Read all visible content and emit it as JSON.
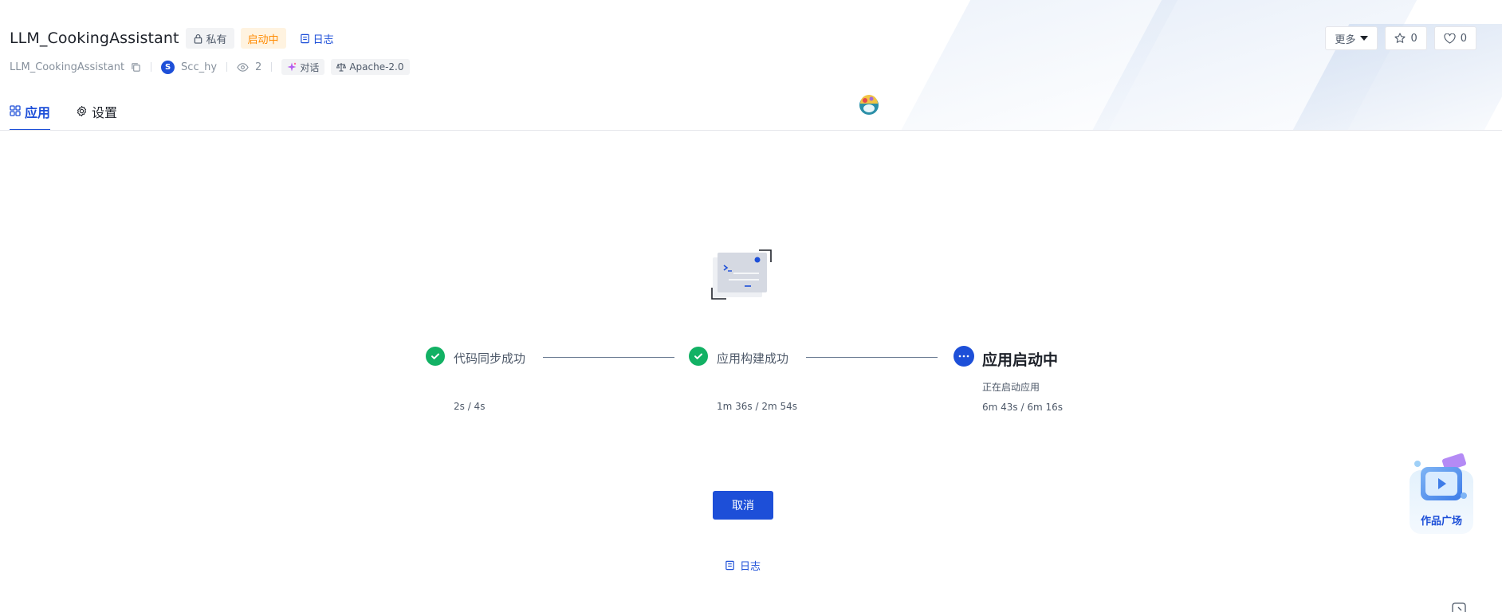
{
  "header": {
    "title": "LLM_CookingAssistant",
    "private_label": "私有",
    "status_label": "启动中",
    "log_label": "日志",
    "repo_name": "LLM_CookingAssistant",
    "owner_avatar": "S",
    "owner_name": "Scc_hy",
    "views": "2",
    "category_tag": "对话",
    "license_tag": "Apache-2.0"
  },
  "actions": {
    "more_label": "更多",
    "star_count": "0",
    "like_count": "0"
  },
  "tabs": [
    {
      "label": "应用",
      "icon": "apps-icon",
      "active": true
    },
    {
      "label": "设置",
      "icon": "gear-icon",
      "active": false
    }
  ],
  "steps": [
    {
      "title": "代码同步成功",
      "time": "2s / 4s",
      "state": "done"
    },
    {
      "title": "应用构建成功",
      "time": "1m 36s / 2m 54s",
      "state": "done"
    },
    {
      "title": "应用启动中",
      "desc": "正在启动应用",
      "time": "6m 43s / 6m 16s",
      "state": "in-progress"
    }
  ],
  "cancel_label": "取消",
  "bottom_log_label": "日志",
  "showcase_label": "作品广场",
  "colors": {
    "primary": "#1d4fd8",
    "success": "#12b164",
    "status_orange": "#ff8a00"
  }
}
